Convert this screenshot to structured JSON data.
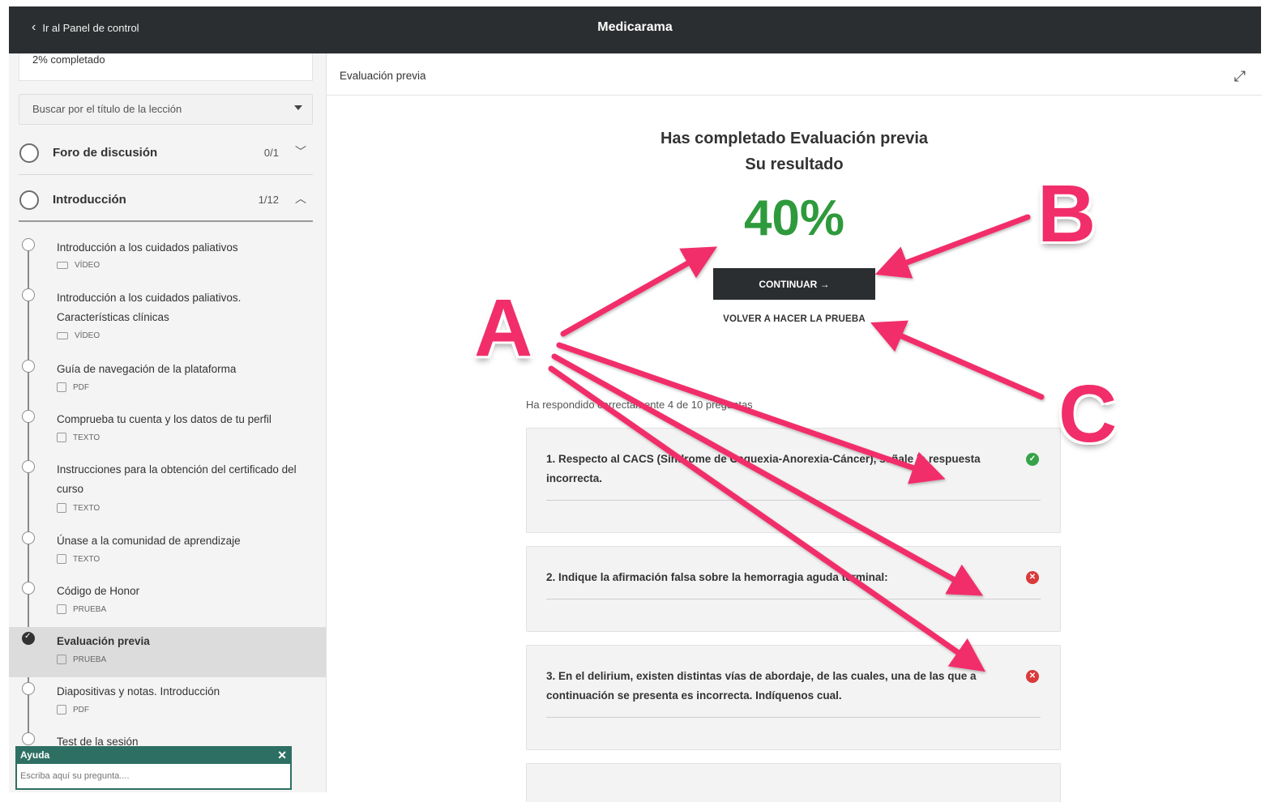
{
  "topbar": {
    "back_label": "Ir al Panel de control",
    "title": "Medicarama"
  },
  "sidebar": {
    "progress_text": "2% completado",
    "search_placeholder": "Buscar por el título de la lección",
    "sections": [
      {
        "label": "Foro de discusión",
        "count": "0/1",
        "expanded": false
      },
      {
        "label": "Introducción",
        "count": "1/12",
        "expanded": true
      }
    ],
    "lessons": [
      {
        "title": "Introducción a los cuidados paliativos",
        "type": "VÍDEO",
        "icon": "video-icon",
        "done": false,
        "active": false
      },
      {
        "title": "Introducción a los cuidados paliativos. Características clínicas",
        "type": "VÍDEO",
        "icon": "video-icon",
        "done": false,
        "active": false
      },
      {
        "title": "Guía de navegación de la plataforma",
        "type": "PDF",
        "icon": "document-icon",
        "done": false,
        "active": false
      },
      {
        "title": "Comprueba tu cuenta y los datos de tu perfil",
        "type": "TEXTO",
        "icon": "text-icon",
        "done": false,
        "active": false
      },
      {
        "title": "Instrucciones para la obtención del certificado del curso",
        "type": "TEXTO",
        "icon": "text-icon",
        "done": false,
        "active": false
      },
      {
        "title": "Únase a la comunidad de aprendizaje",
        "type": "TEXTO",
        "icon": "text-icon",
        "done": false,
        "active": false
      },
      {
        "title": "Código de Honor",
        "type": "PRUEBA",
        "icon": "quiz-icon",
        "done": false,
        "active": false
      },
      {
        "title": "Evaluación previa",
        "type": "PRUEBA",
        "icon": "quiz-icon",
        "done": true,
        "active": true
      },
      {
        "title": "Diapositivas y notas. Introducción",
        "type": "PDF",
        "icon": "document-icon",
        "done": false,
        "active": false
      },
      {
        "title": "Test de la sesión",
        "type": "",
        "icon": "",
        "done": false,
        "active": false
      }
    ],
    "help": {
      "title": "Ayuda",
      "placeholder": "Escriba aquí su pregunta...."
    }
  },
  "main": {
    "header_title": "Evaluación previa",
    "result_title": "Has completado Evaluación previa",
    "result_subtitle": "Su resultado",
    "score": "40%",
    "continue_label": "CONTINUAR →",
    "retry_label": "VOLVER A HACER LA PRUEBA",
    "summary": "Ha respondido correctamente 4 de 10 preguntas",
    "questions": [
      {
        "text": "1. Respecto al CACS (Síndrome de Caquexia-Anorexia-Cáncer), señale la respuesta incorrecta.",
        "status": "correct"
      },
      {
        "text": "2. Indique la afirmación falsa sobre la hemorragia aguda terminal:",
        "status": "incorrect"
      },
      {
        "text": "3. En el delirium, existen distintas vías de abordaje, de las cuales, una de las que a continuación se presenta es incorrecta. Indíquenos cual.",
        "status": "incorrect"
      }
    ]
  },
  "annotations": {
    "labels": [
      "A",
      "B",
      "C"
    ],
    "color": "#f12e6a"
  },
  "colors": {
    "topbar": "#2b2e30",
    "score": "#2e9a3c",
    "correct": "#36a34a",
    "incorrect": "#d93a3a",
    "help": "#2e6f63"
  }
}
